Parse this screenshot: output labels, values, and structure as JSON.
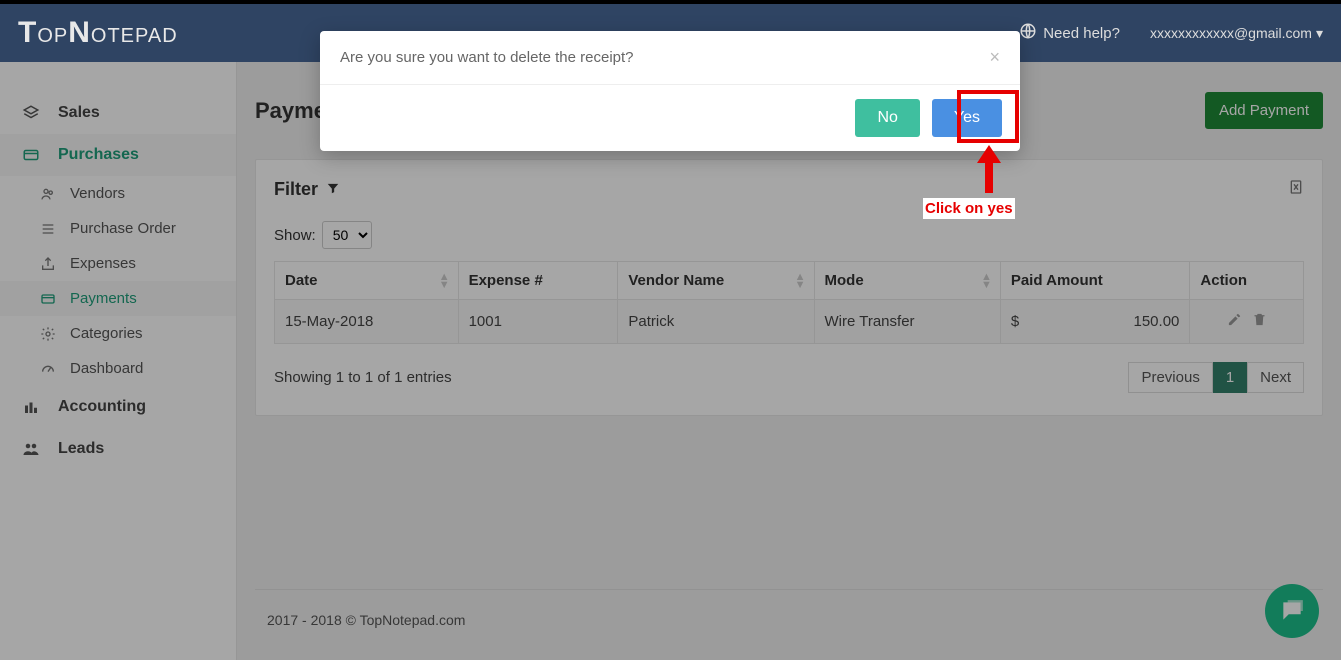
{
  "brand": "TopNotepad",
  "header": {
    "need_help": "Need help?",
    "user_email": "xxxxxxxxxxxx@gmail.com"
  },
  "sidebar": {
    "sales": "Sales",
    "purchases": "Purchases",
    "sub": {
      "vendors": "Vendors",
      "purchase_order": "Purchase Order",
      "expenses": "Expenses",
      "payments": "Payments",
      "categories": "Categories",
      "dashboard": "Dashboard"
    },
    "accounting": "Accounting",
    "leads": "Leads"
  },
  "page": {
    "title": "Payments",
    "add_btn": "Add Payment",
    "filter_label": "Filter",
    "show_label": "Show:",
    "show_value": "50",
    "columns": {
      "date": "Date",
      "expense_no": "Expense #",
      "vendor": "Vendor Name",
      "mode": "Mode",
      "paid": "Paid Amount",
      "action": "Action"
    },
    "rows": [
      {
        "date": "15-May-2018",
        "expense_no": "1001",
        "vendor": "Patrick",
        "mode": "Wire Transfer",
        "currency": "$",
        "amount": "150.00"
      }
    ],
    "showing": "Showing 1 to 1 of 1 entries",
    "pager": {
      "prev": "Previous",
      "page": "1",
      "next": "Next"
    }
  },
  "modal": {
    "message": "Are you sure you want to delete the receipt?",
    "no": "No",
    "yes": "Yes"
  },
  "annotation": "Click on yes",
  "footer": "2017 - 2018 © TopNotepad.com"
}
